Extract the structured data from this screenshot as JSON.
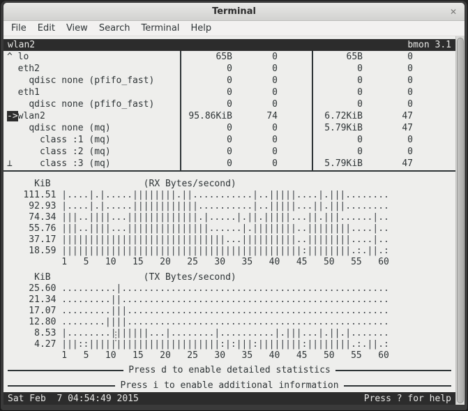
{
  "window": {
    "title": "Terminal",
    "close_glyph": "✕"
  },
  "menu": {
    "items": [
      "File",
      "Edit",
      "View",
      "Search",
      "Terminal",
      "Help"
    ]
  },
  "bmon": {
    "titlebar": {
      "left": "wlan2",
      "right": "bmon 3.1"
    },
    "interfaces": [
      {
        "pre": "^ ",
        "sel": "",
        "name": "lo",
        "rx_rate": "65B",
        "rx_pps": "0",
        "tx_rate": "65B",
        "tx_pps": "0"
      },
      {
        "pre": "  ",
        "sel": "",
        "name": "eth2",
        "rx_rate": "0",
        "rx_pps": "0",
        "tx_rate": "0",
        "tx_pps": "0"
      },
      {
        "pre": "    ",
        "sel": "",
        "name": "qdisc none (pfifo_fast)",
        "rx_rate": "0",
        "rx_pps": "0",
        "tx_rate": "0",
        "tx_pps": "0"
      },
      {
        "pre": "  ",
        "sel": "",
        "name": "eth1",
        "rx_rate": "0",
        "rx_pps": "0",
        "tx_rate": "0",
        "tx_pps": "0"
      },
      {
        "pre": "    ",
        "sel": "",
        "name": "qdisc none (pfifo_fast)",
        "rx_rate": "0",
        "rx_pps": "0",
        "tx_rate": "0",
        "tx_pps": "0"
      },
      {
        "pre": "",
        "sel": "->",
        "name": "wlan2",
        "rx_rate": "95.86KiB",
        "rx_pps": "74",
        "tx_rate": "6.72KiB",
        "tx_pps": "47"
      },
      {
        "pre": "    ",
        "sel": "",
        "name": "qdisc none (mq)",
        "rx_rate": "0",
        "rx_pps": "0",
        "tx_rate": "5.79KiB",
        "tx_pps": "47"
      },
      {
        "pre": "      ",
        "sel": "",
        "name": "class :1 (mq)",
        "rx_rate": "0",
        "rx_pps": "0",
        "tx_rate": "0",
        "tx_pps": "0"
      },
      {
        "pre": "      ",
        "sel": "",
        "name": "class :2 (mq)",
        "rx_rate": "0",
        "rx_pps": "0",
        "tx_rate": "0",
        "tx_pps": "0"
      },
      {
        "pre": "⊥     ",
        "sel": "",
        "name": "class :3 (mq)",
        "rx_rate": "0",
        "rx_pps": "0",
        "tx_rate": "5.79KiB",
        "tx_pps": "47"
      }
    ],
    "rx_graph": {
      "unit": "KiB",
      "title": "(RX Bytes/second)",
      "header_line": "     KiB                 (RX Bytes/second)",
      "rows": [
        {
          "label": "111.51",
          "bars": "|....|.|.....||||||||.||...........|..|||||....|.|||........"
        },
        {
          "label": "92.93",
          "bars": "|....|.|.....||||||||||||..........|..|||||...||.|||........"
        },
        {
          "label": "74.34",
          "bars": "|||..||||...|||||||||||||.|.....|.||.|||||...||.|||......|.."
        },
        {
          "label": "55.76",
          "bars": "|||..||||...|||||||||||||||......|.||||||||..||||||||....|.."
        },
        {
          "label": "37.17",
          "bars": "||||||||||||||||||||||||||||||...||||||||||..||||||||....|.."
        },
        {
          "label": "18.59",
          "bars": "||||||||||||||||||||||||||||||||||||||||||||:||||||||.:.||.:"
        }
      ],
      "axis_line": "          1   5   10   15   20   25   30   35   40   45   50   55   60"
    },
    "tx_graph": {
      "unit": "KiB",
      "title": "(TX Bytes/second)",
      "header_line": "     KiB                 (TX Bytes/second)",
      "rows": [
        {
          "label": "25.60",
          "bars": "..........|................................................."
        },
        {
          "label": "21.34",
          "bars": ".........||................................................."
        },
        {
          "label": "17.07",
          "bars": ".........|||................................................"
        },
        {
          "label": "12.80",
          "bars": "........||||................................................"
        },
        {
          "label": "8.53",
          "bars": "|........|||||||...|........|..........|.|||...|.||.|......."
        },
        {
          "label": "4.27",
          "bars": "|||::||||||||||||||||||||||||:|:|||:||||||||:||||||||.:.||.:"
        }
      ],
      "axis_line": "          1   5   10   15   20   25   30   35   40   45   50   55   60"
    },
    "messages": [
      "Press d to enable detailed statistics",
      "Press i to enable additional information"
    ],
    "statusbar": {
      "left": "Sat Feb  7 04:54:49 2015",
      "right": "Press ? for help"
    }
  },
  "colors": {
    "terminal_bg": "#eeeeec",
    "terminal_fg": "#2e3436",
    "inverse_bg": "#2c2c2c",
    "inverse_fg": "#e8e8e6",
    "titlebar_bg": "#dcdcda"
  }
}
